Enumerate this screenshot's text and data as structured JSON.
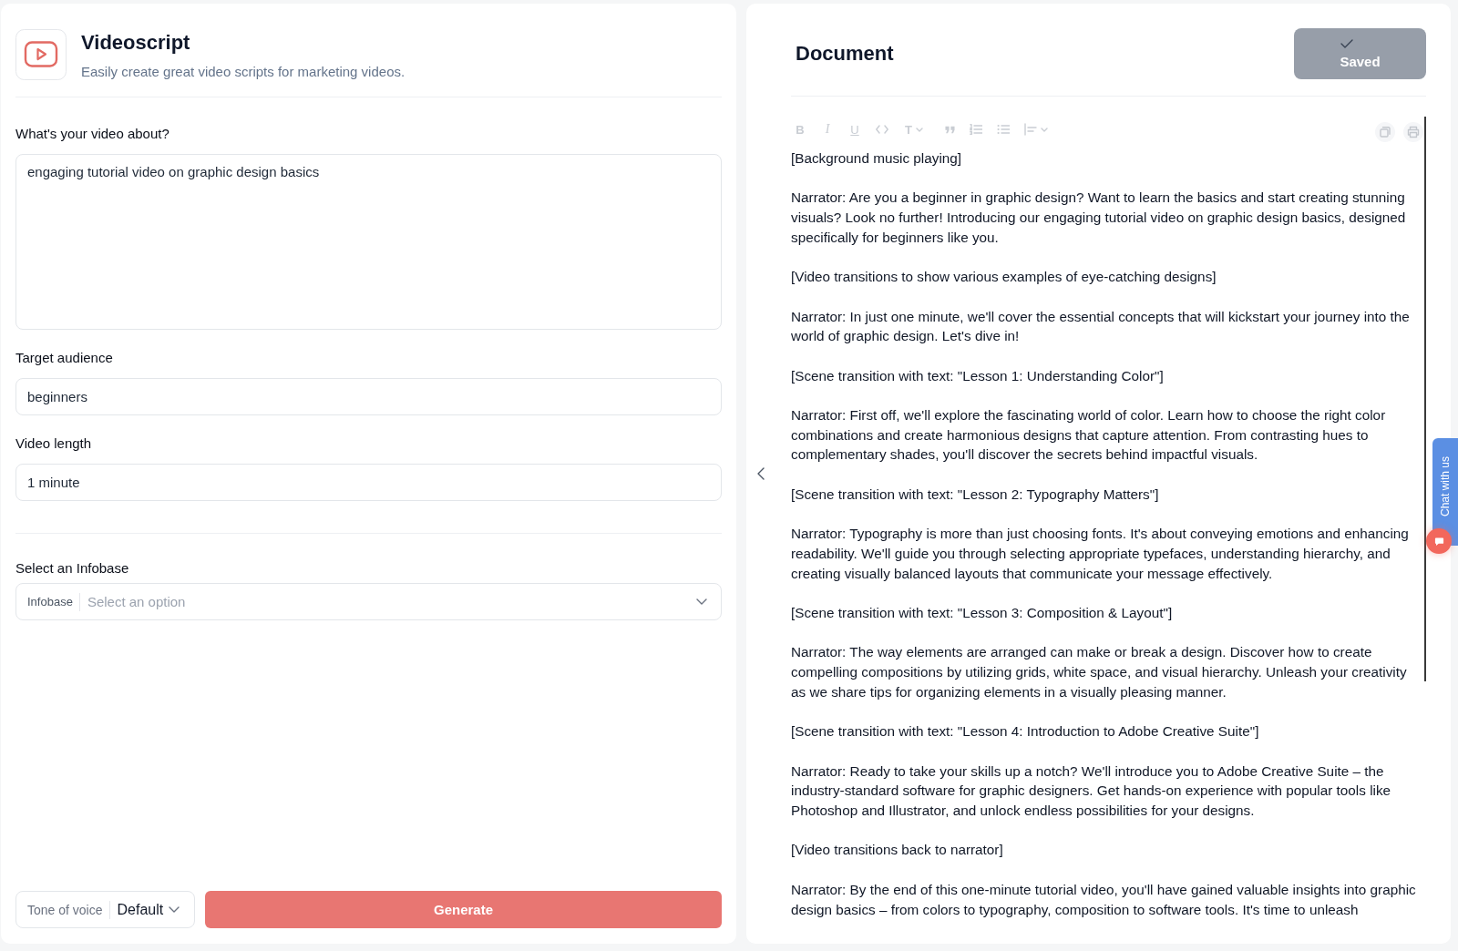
{
  "app": {
    "title": "Videoscript",
    "subtitle": "Easily create great video scripts for marketing videos."
  },
  "form": {
    "fields": [
      {
        "kind": "textarea",
        "label": "What's your video about?",
        "value": "engaging tutorial video on graphic design basics"
      },
      {
        "kind": "input",
        "label": "Target audience",
        "value": "beginners"
      },
      {
        "kind": "input",
        "label": "Video length",
        "value": "1 minute"
      }
    ],
    "infobase": {
      "label": "Select an Infobase",
      "prefix": "Infobase",
      "placeholder": "Select an option"
    },
    "tone": {
      "prefix": "Tone of voice",
      "value": "Default"
    },
    "generate_button": "Generate"
  },
  "document": {
    "title": "Document",
    "save_button": {
      "label": "Saved",
      "saved": true
    },
    "toolbar": [
      {
        "kind": "bold",
        "glyph": "B",
        "dropdown": false
      },
      {
        "kind": "italic",
        "glyph": "I",
        "dropdown": false
      },
      {
        "kind": "underline",
        "glyph": "U",
        "dropdown": false
      },
      {
        "kind": "code",
        "dropdown": false
      },
      {
        "kind": "heading",
        "glyph": "T",
        "dropdown": true
      },
      {
        "kind": "quote",
        "dropdown": false
      },
      {
        "kind": "ordered-list",
        "dropdown": false
      },
      {
        "kind": "bullet-list",
        "dropdown": false
      },
      {
        "kind": "align",
        "dropdown": true
      }
    ],
    "paragraphs": [
      "[Background music playing]",
      "Narrator: Are you a beginner in graphic design? Want to learn the basics and start creating stunning visuals? Look no further! Introducing our engaging tutorial video on graphic design basics, designed specifically for beginners like you.",
      "[Video transitions to show various examples of eye-catching designs]",
      "Narrator: In just one minute, we'll cover the essential concepts that will kickstart your journey into the world of graphic design. Let's dive in!",
      "[Scene transition with text: \"Lesson 1: Understanding Color\"]",
      "Narrator: First off, we'll explore the fascinating world of color. Learn how to choose the right color combinations and create harmonious designs that capture attention. From contrasting hues to complementary shades, you'll discover the secrets behind impactful visuals.",
      "[Scene transition with text: \"Lesson 2: Typography Matters\"]",
      "Narrator: Typography is more than just choosing fonts. It's about conveying emotions and enhancing readability. We'll guide you through selecting appropriate typefaces, understanding hierarchy, and creating visually balanced layouts that communicate your message effectively.",
      "[Scene transition with text: \"Lesson 3: Composition & Layout\"]",
      "Narrator: The way elements are arranged can make or break a design. Discover how to create compelling compositions by utilizing grids, white space, and visual hierarchy. Unleash your creativity as we share tips for organizing elements in a visually pleasing manner.",
      "[Scene transition with text: \"Lesson 4: Introduction to Adobe Creative Suite\"]",
      "Narrator: Ready to take your skills up a notch? We'll introduce you to Adobe Creative Suite – the industry-standard software for graphic designers. Get hands-on experience with popular tools like Photoshop and Illustrator, and unlock endless possibilities for your designs.",
      "[Video transitions back to narrator]",
      "Narrator: By the end of this one-minute tutorial video, you'll have gained valuable insights into graphic design basics – from colors to typography, composition to software tools. It's time to unleash"
    ]
  },
  "chat_widget": {
    "label": "Chat with us"
  }
}
